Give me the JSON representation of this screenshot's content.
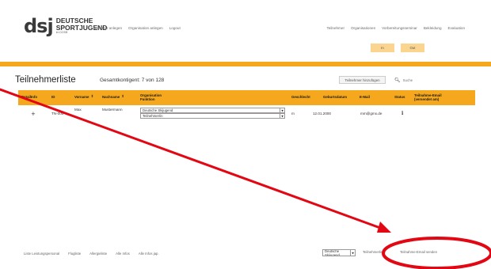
{
  "header": {
    "logo": {
      "mark": "dsj",
      "line1": "DEUTSCHE",
      "line2": "SPORTJUGEND",
      "line3": "im DOSB"
    },
    "nav_left": [
      "Benutzer anlegen",
      "Organisation anlegen",
      "Logout"
    ],
    "nav_right": [
      "Teilnehmer",
      "Organisationen",
      "Vorbereitungsseminar",
      "Bekleidung",
      "Evaluation"
    ],
    "in_label": "In",
    "out_label": "Out"
  },
  "page": {
    "title": "Teilnehmerliste",
    "subtitle": "Gesamtkontigent: 7 von 128",
    "add_button": "Teilnehmer hinzufügen",
    "search_placeholder": "Suche"
  },
  "table": {
    "columns": {
      "detail": "DetailInfo",
      "id": "ID",
      "vorname": "Vorname",
      "nachname": "Nachname",
      "org1": "Organisation",
      "org2": "Funktion",
      "geschlecht": "Geschlecht",
      "geburtsdatum": "Geburtsdatum",
      "email": "E-Mail",
      "status": "Status",
      "tmail1": "Teilnahme-Email",
      "tmail2": "(versendet am)"
    },
    "row": {
      "expand": "+",
      "id": "TN-000",
      "vorname": "Max",
      "nachname": "Mustermann",
      "organisation": "Deutsche Skijugend",
      "funktion": "Teilnehmer/in",
      "geschlecht": "m",
      "geburtsdatum": "12.01.2000",
      "email": "mm@gmx.de",
      "status": "i"
    }
  },
  "footer": {
    "buttons": [
      "Liste Leistungspersonal",
      "Flugliste",
      "Allergieliste",
      "Alle Infos",
      "Alle Infos jap."
    ],
    "org_select": "Deutsche Skijugend",
    "right1": "Teilnehmerliste",
    "right2": "Teilnahme-Email senden"
  },
  "annotation": {
    "color": "#e30613"
  },
  "icons": {
    "search": "search-icon",
    "sort": "sort-icon",
    "dropdown": "chevron-down-icon",
    "info": "info-icon"
  }
}
